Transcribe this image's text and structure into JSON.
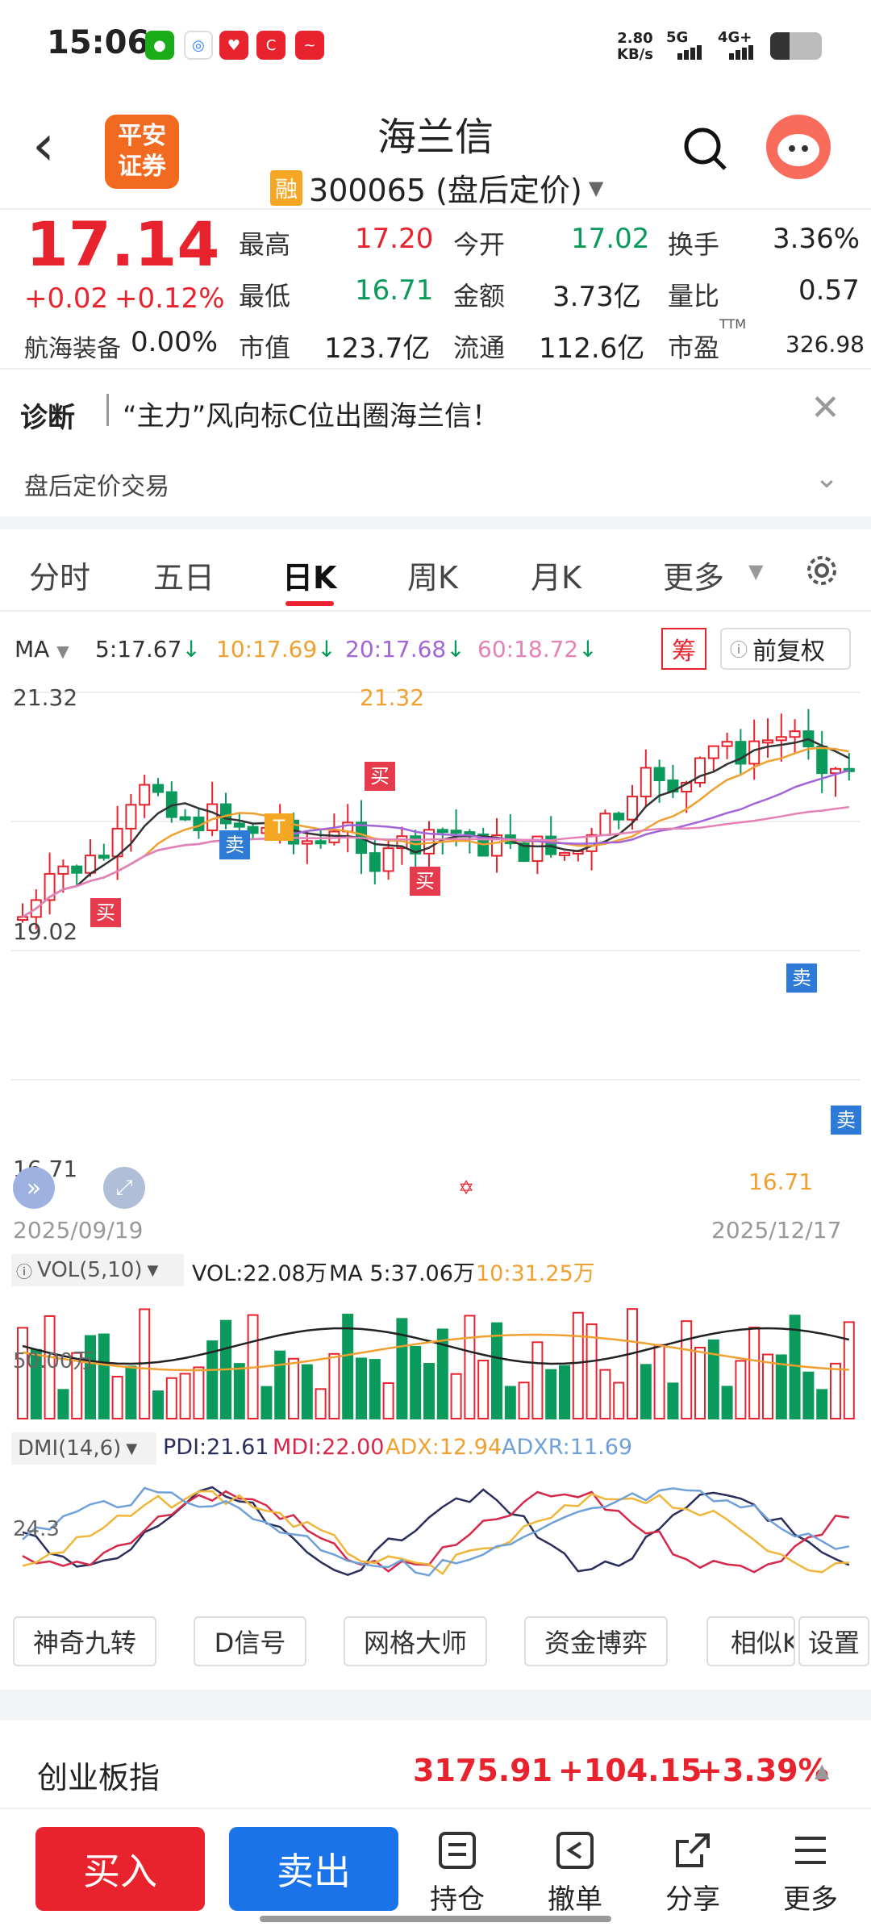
{
  "status": {
    "time": "15:06",
    "net_speed": "2.80\nKB/s",
    "net1": "5G",
    "net2": "4G+"
  },
  "header": {
    "back": "‹",
    "logo": "平安\n证券",
    "title": "海兰信",
    "rong": "融",
    "code": "300065 (盘后定价)"
  },
  "quote": {
    "price": "17.14",
    "change": "+0.02",
    "change_pct": "+0.12%",
    "sector_name": "航海装备",
    "sector_pct": "0.00%",
    "high_label": "最高",
    "high": "17.20",
    "open_label": "今开",
    "open": "17.02",
    "turnover_label": "换手",
    "turnover": "3.36%",
    "low_label": "最低",
    "low": "16.71",
    "amount_label": "金额",
    "amount": "3.73亿",
    "vratio_label": "量比",
    "vratio": "0.57",
    "mcap_label": "市值",
    "mcap": "123.7亿",
    "float_label": "流通",
    "float": "112.6亿",
    "pe_label": "市盈",
    "pe_sup": "TTM",
    "pe": "326.98"
  },
  "diagnosis": {
    "label": "诊断",
    "text": "“主力”风向标C位出圈海兰信！",
    "after_hours": "盘后定价交易"
  },
  "tabs": [
    "分时",
    "五日",
    "日K",
    "周K",
    "月K",
    "更多"
  ],
  "active_tab": "日K",
  "ma": {
    "label": "MA",
    "ma5": "5:17.67",
    "ma10": "10:17.69",
    "ma20": "20:17.68",
    "ma60": "60:18.72",
    "chou": "筹",
    "fq": "前复权"
  },
  "kchart": {
    "max_label": "21.32",
    "mid_label": "19.02",
    "min_label": "16.71",
    "max_annot": "21.32",
    "min_annot": "16.71",
    "start_date": "2025/09/19",
    "end_date": "2025/12/17",
    "signal_buy": "买",
    "signal_sell": "卖",
    "signal_t": "T"
  },
  "vol": {
    "label": "VOL(5,10)",
    "vol": "VOL:22.08万",
    "ma5": "MA 5:37.06万",
    "ma10": "10:31.25万",
    "axis": "50.00万"
  },
  "dmi": {
    "label": "DMI(14,6)",
    "pdi": "PDI:21.61",
    "mdi": "MDI:22.00",
    "adx": "ADX:12.94",
    "adxr": "ADXR:11.69",
    "axis": "24.3"
  },
  "tools": [
    "神奇九转",
    "D信号",
    "网格大师",
    "资金博弈",
    "相似K",
    "设置"
  ],
  "index": {
    "name": "创业板指",
    "value": "3175.91",
    "change": "+104.15",
    "pct": "+3.39%"
  },
  "bottom": {
    "buy": "买入",
    "sell": "卖出",
    "hold": "持仓",
    "cancel": "撤单",
    "share": "分享",
    "more": "更多"
  },
  "colors": {
    "red": "#e8232d",
    "green": "#0a9a5c",
    "buy_btn": "#e8232d",
    "sell_btn": "#1a73e8"
  }
}
